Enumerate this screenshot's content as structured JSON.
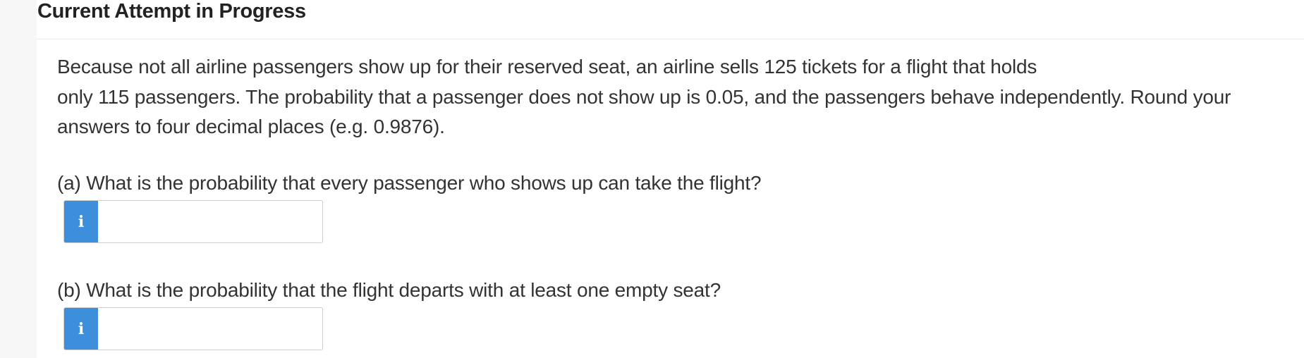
{
  "header": {
    "title": "Current Attempt in Progress"
  },
  "problem": {
    "line1": "Because not all airline passengers show up for their reserved seat, an airline sells 125 tickets for a flight that holds",
    "line2": "only 115 passengers. The probability that a passenger does not show up is 0.05, and the passengers behave independently. Round your",
    "line3": "answers to four decimal places (e.g. 0.9876)."
  },
  "questions": [
    {
      "text": "(a) What is the probability that every passenger who shows up can take the flight?",
      "info_icon": "i",
      "answer_value": ""
    },
    {
      "text": "(b) What is the probability that the flight departs with at least one empty seat?",
      "info_icon": "i",
      "answer_value": ""
    }
  ],
  "colors": {
    "info_button": "#3d8fdc",
    "text": "#333333",
    "divider": "#ececec"
  }
}
